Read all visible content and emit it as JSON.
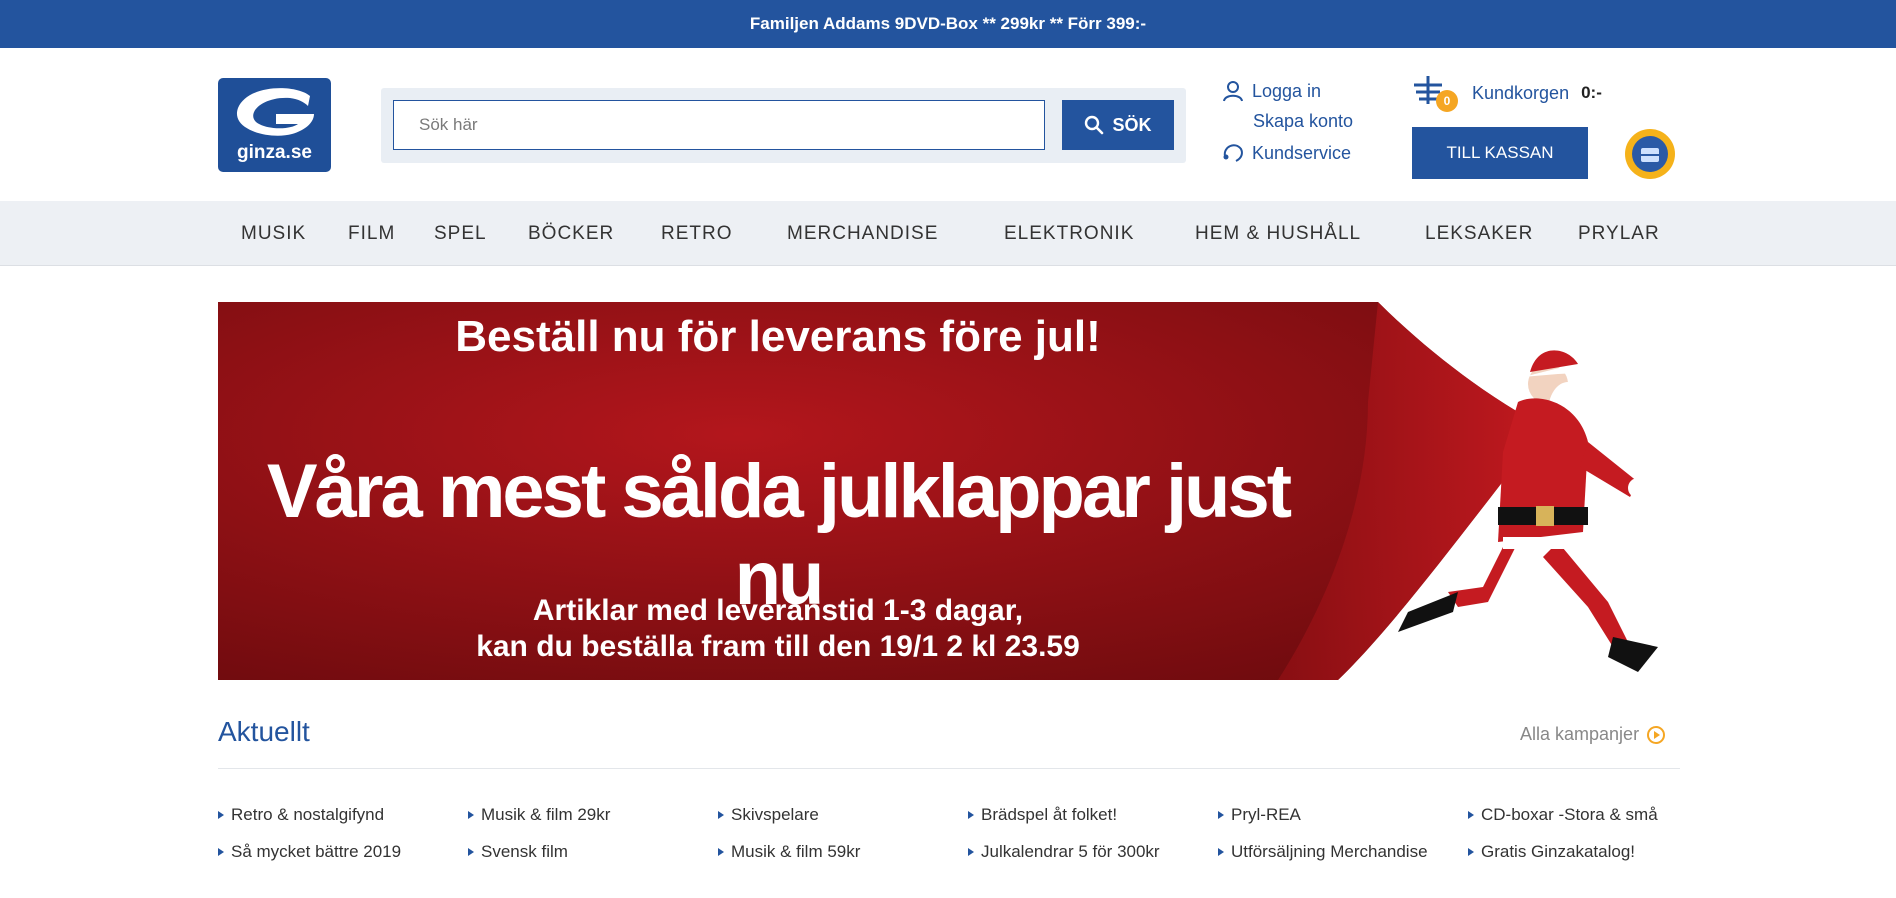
{
  "promo_bar": {
    "text": "Familjen Addams 9DVD-Box ** 299kr ** Förr 399:-"
  },
  "logo": {
    "text": "ginza.se"
  },
  "search": {
    "placeholder": "Sök här",
    "button_label": "SÖK"
  },
  "account": {
    "login": "Logga in",
    "create": "Skapa konto",
    "support": "Kundservice"
  },
  "cart": {
    "label": "Kundkorgen",
    "count": "0",
    "total": "0:-",
    "checkout": "TILL KASSAN"
  },
  "colors": {
    "brand": "#23549e",
    "banner_red": "#a81218",
    "accent": "#f5a623"
  },
  "nav": [
    "MUSIK",
    "FILM",
    "SPEL",
    "BÖCKER",
    "RETRO",
    "MERCHANDISE",
    "ELEKTRONIK",
    "HEM & HUSHÅLL",
    "LEKSAKER",
    "PRYLAR"
  ],
  "banner": {
    "line1": "Beställ nu för leverans före jul!",
    "headline": "Våra mest sålda julklappar just nu",
    "line3a": "Artiklar med leveranstid 1-3 dagar,",
    "line3b": "kan du beställa fram till den 19/1 2 kl 23.59"
  },
  "aktuellt": {
    "title": "Aktuellt",
    "all_link": "Alla kampanjer",
    "links": [
      "Retro & nostalgifynd",
      "Musik & film 29kr",
      "Skivspelare",
      "Brädspel åt folket!",
      "Pryl-REA",
      "CD-boxar -Stora & små",
      "Så mycket bättre 2019",
      "Svensk film",
      "Musik & film 59kr",
      "Julkalendrar 5 för 300kr",
      "Utförsäljning Merchandise",
      "Gratis Ginzakatalog!"
    ]
  }
}
